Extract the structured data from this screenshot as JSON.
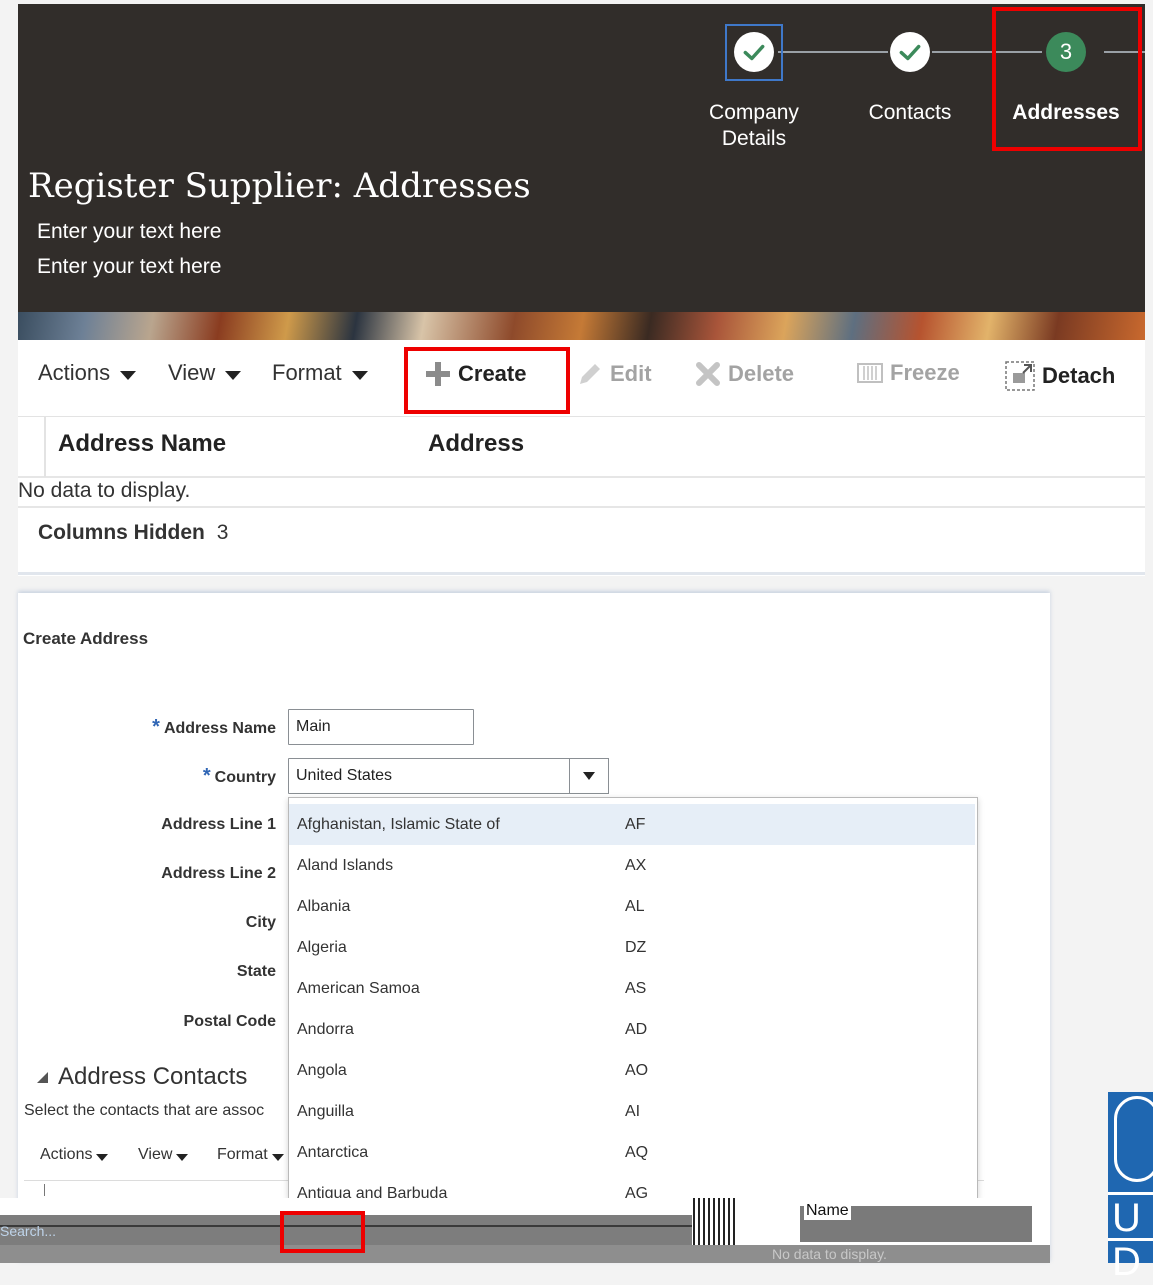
{
  "wizard": {
    "steps": [
      {
        "label": "Company Details",
        "label_line1": "Company",
        "label_line2": "Details",
        "state": "completed"
      },
      {
        "label": "Contacts",
        "state": "completed"
      },
      {
        "label": "Addresses",
        "number": "3",
        "state": "current"
      }
    ]
  },
  "header": {
    "title": "Register Supplier: Addresses",
    "subtitle_1": "Enter your text here",
    "subtitle_2": "Enter your text here"
  },
  "toolbar": {
    "actions": "Actions",
    "view": "View",
    "format": "Format",
    "create": "Create",
    "edit": "Edit",
    "delete": "Delete",
    "freeze": "Freeze",
    "detach": "Detach"
  },
  "table": {
    "columns": [
      "Address Name",
      "Address"
    ],
    "empty_text": "No data to display.",
    "columns_hidden_label": "Columns Hidden",
    "columns_hidden_count": "3"
  },
  "create_address": {
    "title": "Create Address",
    "fields": {
      "address_name_label": "Address Name",
      "address_name_value": "Main",
      "country_label": "Country",
      "country_value": "United States",
      "address_line1_label": "Address Line 1",
      "address_line2_label": "Address Line 2",
      "city_label": "City",
      "state_label": "State",
      "postal_code_label": "Postal Code"
    },
    "required_marker": "*",
    "country_options": [
      {
        "name": "Afghanistan, Islamic State of",
        "code": "AF"
      },
      {
        "name": "Aland Islands",
        "code": "AX"
      },
      {
        "name": "Albania",
        "code": "AL"
      },
      {
        "name": "Algeria",
        "code": "DZ"
      },
      {
        "name": "American Samoa",
        "code": "AS"
      },
      {
        "name": "Andorra",
        "code": "AD"
      },
      {
        "name": "Angola",
        "code": "AO"
      },
      {
        "name": "Anguilla",
        "code": "AI"
      },
      {
        "name": "Antarctica",
        "code": "AQ"
      },
      {
        "name": "Antigua and Barbuda",
        "code": "AG"
      }
    ],
    "contacts_section": {
      "title": "Address Contacts",
      "description": "Select the contacts that are assoc",
      "actions": "Actions",
      "view": "View",
      "format": "Format"
    }
  },
  "glitch_strip": {
    "search_placeholder": "Search...",
    "name_header": "Name",
    "empty_text": "No data to display."
  },
  "logo": {
    "letter_1": "U",
    "letter_2": "D"
  },
  "colors": {
    "header_bg": "#312d2a",
    "current_step": "#3c8a5b",
    "check": "#3c8a5b",
    "highlight": "#ee0000",
    "required": "#3066b5",
    "logo_blue": "#1f67b1"
  }
}
